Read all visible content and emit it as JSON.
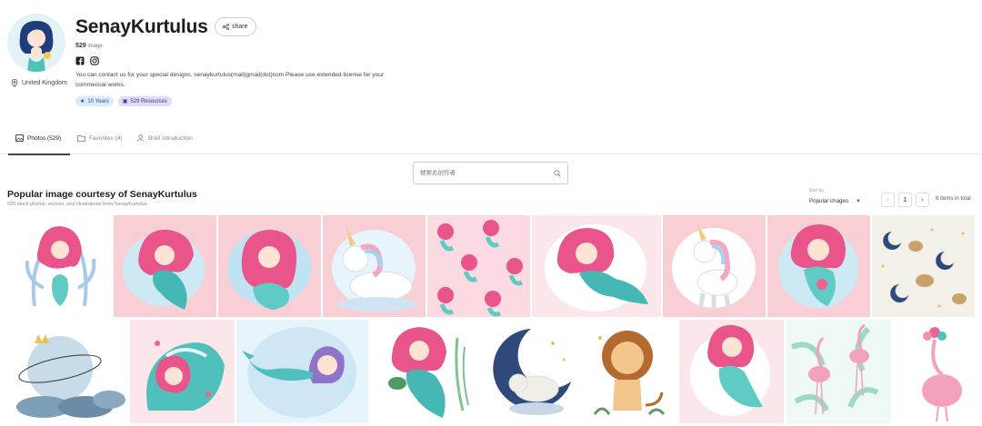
{
  "profile": {
    "name": "SenayKurtulus",
    "share_label": "share",
    "count_value": "529",
    "count_unit": "image",
    "location": "United Kingdom",
    "description": "You can contact us for your special designs. senaykurtulus(mail)gmail(dot)com Please use extended license for your commercial works.",
    "badges": {
      "years": "10 Years",
      "resources": "529 Resources"
    },
    "socials": [
      "facebook-icon",
      "instagram-icon"
    ]
  },
  "tabs": [
    {
      "label": "Photos (529)",
      "icon": "photo-icon",
      "active": true
    },
    {
      "label": "Favorites (4)",
      "icon": "folder-icon",
      "active": false
    },
    {
      "label": "Brief introduction",
      "icon": "user-icon",
      "active": false
    }
  ],
  "search": {
    "placeholder": "搜索此创作者"
  },
  "section": {
    "title": "Popular image courtesy of SenayKurtulus",
    "subtitle": "529 stock photos, vectors, and illustrations from SenayKurtulus."
  },
  "sort": {
    "label": "Sort by",
    "value": "Popular images"
  },
  "pagination": {
    "prev": "‹",
    "current": "1",
    "next": "›",
    "total": "6 items in total"
  },
  "gallery": {
    "row1": [
      "mermaid with coral",
      "mermaid with starfish",
      "sleeping mermaid",
      "unicorn resting",
      "mermaid pattern",
      "mermaid with shell",
      "rainbow unicorn",
      "pink mermaid",
      "moon and stars pattern"
    ],
    "row2": [
      "sleeping moon",
      "mermaid in wave",
      "purple haired mermaid",
      "mermaid with turtle",
      "lamb on moon",
      "lion",
      "mermaid in bubble",
      "flamingo tropical",
      "flamingo with flowers"
    ]
  },
  "colors": {
    "accent": "#e9548a",
    "teal": "#54c3c0",
    "badge_blue": "#d9ecfb",
    "badge_purple": "#e2d9fb"
  }
}
